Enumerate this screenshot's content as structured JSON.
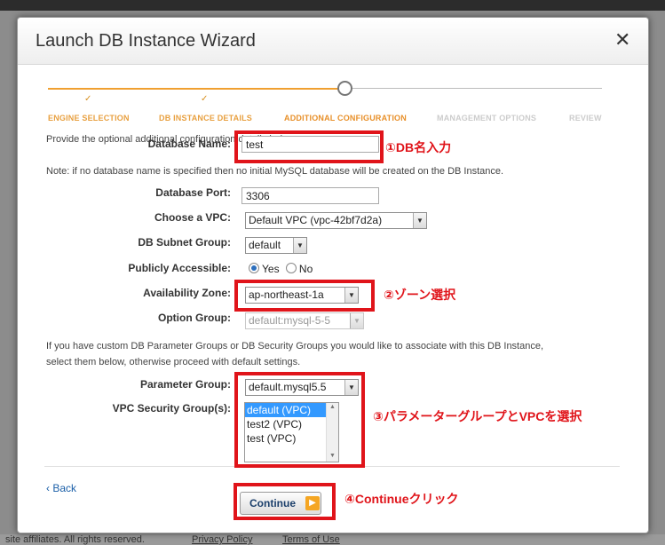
{
  "background": {
    "footer_text": "site affiliates. All rights reserved.",
    "footer_links": [
      "Privacy Policy",
      "Terms of Use"
    ]
  },
  "modal": {
    "title": "Launch DB Instance Wizard",
    "close_glyph": "✕"
  },
  "wizard": {
    "steps": [
      {
        "label": "ENGINE SELECTION",
        "state": "done"
      },
      {
        "label": "DB INSTANCE DETAILS",
        "state": "done"
      },
      {
        "label": "ADDITIONAL CONFIGURATION",
        "state": "active"
      },
      {
        "label": "MANAGEMENT OPTIONS",
        "state": "pending"
      },
      {
        "label": "REVIEW",
        "state": "pending"
      }
    ],
    "done_glyph": "✓"
  },
  "form": {
    "intro": "Provide the optional additional configuration details below.",
    "database_name": {
      "label": "Database Name:",
      "value": "test"
    },
    "note": "Note: if no database name is specified then no initial MySQL database will be created on the DB Instance.",
    "database_port": {
      "label": "Database Port:",
      "value": "3306"
    },
    "vpc": {
      "label": "Choose a VPC:",
      "value": "Default VPC (vpc-42bf7d2a)"
    },
    "subnet_group": {
      "label": "DB Subnet Group:",
      "value": "default"
    },
    "publicly_accessible": {
      "label": "Publicly Accessible:",
      "yes": "Yes",
      "no": "No",
      "selected": "Yes"
    },
    "availability_zone": {
      "label": "Availability Zone:",
      "value": "ap-northeast-1a"
    },
    "option_group": {
      "label": "Option Group:",
      "value": "default:mysql-5-5"
    },
    "groups_info_line1": "If you have custom DB Parameter Groups or DB Security Groups you would like to associate with this DB Instance,",
    "groups_info_line2": "select them below, otherwise proceed with default settings.",
    "parameter_group": {
      "label": "Parameter Group:",
      "value": "default.mysql5.5"
    },
    "security_groups": {
      "label": "VPC Security Group(s):",
      "options": [
        "default (VPC)",
        "test2 (VPC)",
        "test (VPC)"
      ],
      "selected": "default (VPC)"
    }
  },
  "footer": {
    "back_label": "‹ Back",
    "continue_label": "Continue"
  },
  "annotations": {
    "db_name": "①DB名入力",
    "zone": "②ゾーン選択",
    "groups": "③パラメーターグループとVPCを選択",
    "continue": "④Continueクリック"
  },
  "colors": {
    "annotation_red": "#e0141a",
    "step_active": "#e8902a",
    "link_blue": "#1b5fa8",
    "listbox_selected": "#3399ff"
  }
}
